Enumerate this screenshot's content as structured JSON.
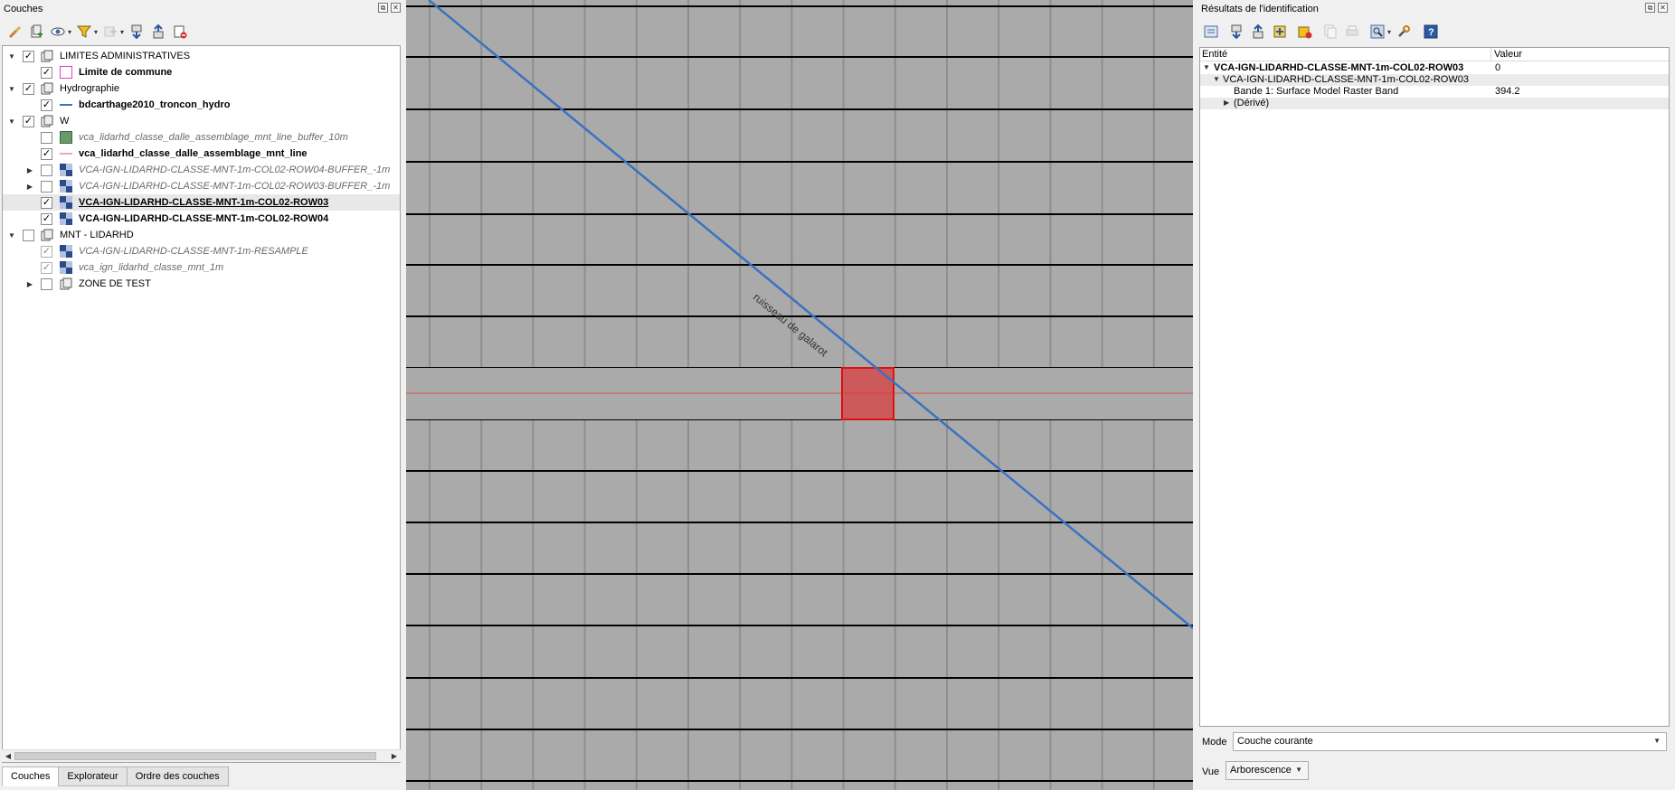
{
  "left_dock": {
    "title": "Couches",
    "float_icon": "⧉",
    "close_icon": "✕",
    "toolbar_icons": [
      "style-paint-icon",
      "add-group-icon",
      "visibility-eye-icon",
      "filter-icon",
      "filter-legend-icon",
      "expand-all-icon",
      "collapse-all-icon",
      "remove-layer-icon"
    ],
    "layers": [
      {
        "label": "LIMITES ADMINISTRATIVES",
        "type": "group",
        "expanded": true,
        "checked": true
      },
      {
        "label": "Limite de commune",
        "type": "polygon-outline",
        "checked": true,
        "style": "bold",
        "color": "#e040c0"
      },
      {
        "label": "Hydrographie",
        "type": "group",
        "expanded": true,
        "checked": true
      },
      {
        "label": "bdcarthage2010_troncon_hydro",
        "type": "line",
        "checked": true,
        "style": "bold",
        "color": "#3b72c0"
      },
      {
        "label": "W",
        "type": "group",
        "expanded": true,
        "checked": true
      },
      {
        "label": "vca_lidarhd_classe_dalle_assemblage_mnt_line_buffer_10m",
        "type": "polygon-fill",
        "checked": false,
        "style": "italic",
        "color": "#6a9a6a"
      },
      {
        "label": "vca_lidarhd_classe_dalle_assemblage_mnt_line",
        "type": "line",
        "checked": true,
        "style": "bold",
        "color": "#e05050"
      },
      {
        "label": "VCA-IGN-LIDARHD-CLASSE-MNT-1m-COL02-ROW04-BUFFER_-1m",
        "type": "raster",
        "checked": false,
        "style": "italic",
        "expandable": true
      },
      {
        "label": "VCA-IGN-LIDARHD-CLASSE-MNT-1m-COL02-ROW03-BUFFER_-1m",
        "type": "raster",
        "checked": false,
        "style": "italic",
        "expandable": true
      },
      {
        "label": "VCA-IGN-LIDARHD-CLASSE-MNT-1m-COL02-ROW03",
        "type": "raster",
        "checked": true,
        "style": "bold-underline",
        "selected": true
      },
      {
        "label": "VCA-IGN-LIDARHD-CLASSE-MNT-1m-COL02-ROW04",
        "type": "raster",
        "checked": true,
        "style": "bold"
      },
      {
        "label": "MNT - LIDARHD",
        "type": "group",
        "expanded": true,
        "checked": false
      },
      {
        "label": "VCA-IGN-LIDARHD-CLASSE-MNT-1m-RESAMPLE",
        "type": "raster",
        "checked": true,
        "style": "italic"
      },
      {
        "label": "vca_ign_lidarhd_classe_mnt_1m",
        "type": "raster",
        "checked": true,
        "style": "italic"
      },
      {
        "label": "ZONE DE TEST",
        "type": "group",
        "expanded": false,
        "checked": false
      }
    ],
    "tabs": [
      "Couches",
      "Explorateur",
      "Ordre des couches"
    ],
    "active_tab": "Couches"
  },
  "map": {
    "river_label": "ruisseau de galarot",
    "river_color": "#3b72c0",
    "tile_line_color": "#000000",
    "highlight_color": "#e03030",
    "background": "#aaaaaa"
  },
  "right_dock": {
    "title": "Résultats de l'identification",
    "float_icon": "⧉",
    "close_icon": "✕",
    "toolbar_icons": [
      "expand-tree-icon",
      "expand-new-icon",
      "collapse-all-icon",
      "expand-all-icon",
      "clear-results-icon",
      "copy-feature-icon",
      "print-icon",
      "identify-mode-icon",
      "settings-icon",
      "help-icon"
    ],
    "columns": [
      "Entité",
      "Valeur"
    ],
    "rows": [
      {
        "entity": "VCA-IGN-LIDARHD-CLASSE-MNT-1m-COL02-ROW03",
        "value": "0",
        "level": 0,
        "bold": true,
        "arrow": "▼"
      },
      {
        "entity": "VCA-IGN-LIDARHD-CLASSE-MNT-1m-COL02-ROW03",
        "value": "",
        "level": 1,
        "bold": false,
        "arrow": "▼"
      },
      {
        "entity": "Bande 1: Surface Model Raster Band",
        "value": "394.2",
        "level": 2,
        "bold": false,
        "arrow": ""
      },
      {
        "entity": "(Dérivé)",
        "value": "",
        "level": 2,
        "bold": false,
        "arrow": "▶"
      }
    ],
    "mode_label": "Mode",
    "mode_value": "Couche courante",
    "view_label": "Vue",
    "view_value": "Arborescence"
  }
}
